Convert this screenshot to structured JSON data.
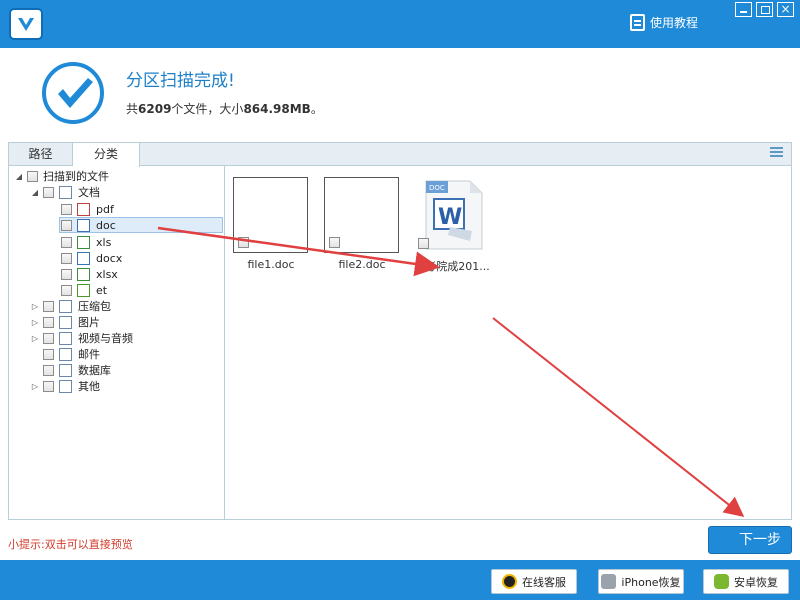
{
  "titlebar": {
    "tutorial_label": "使用教程",
    "close_glyph": "×"
  },
  "header": {
    "title": "分区扫描完成!",
    "stats_prefix": "共",
    "file_count": "6209",
    "stats_middle": "个文件，大小",
    "total_size": "864.98MB",
    "stats_suffix": "。"
  },
  "tabs": [
    {
      "label": "路径"
    },
    {
      "label": "分类"
    }
  ],
  "tree": {
    "root": {
      "label": "扫描到的文件",
      "expander": "◢"
    },
    "documents": {
      "label": "文档",
      "expander": "◢"
    },
    "doc_types": [
      {
        "label": "pdf"
      },
      {
        "label": "doc"
      },
      {
        "label": "xls"
      },
      {
        "label": "docx"
      },
      {
        "label": "xlsx"
      },
      {
        "label": "et"
      }
    ],
    "categories": [
      {
        "label": "压缩包",
        "expander": "▷"
      },
      {
        "label": "图片",
        "expander": "▷"
      },
      {
        "label": "视频与音频",
        "expander": "▷"
      },
      {
        "label": "邮件",
        "expander": ""
      },
      {
        "label": "数据库",
        "expander": ""
      },
      {
        "label": "其他",
        "expander": "▷"
      }
    ]
  },
  "files": [
    {
      "name": "file1.doc"
    },
    {
      "name": "file2.doc"
    },
    {
      "name": "睿考院成201...",
      "badge": "DOC"
    }
  ],
  "hint": "小提示:双击可以直接预览",
  "next_label": "下一步",
  "footer": {
    "service_label": "在线客服",
    "iphone_label": "iPhone恢复",
    "android_label": "安卓恢复"
  },
  "colors": {
    "primary": "#1e8ad8",
    "hint": "#d43a2a",
    "arrow": "#e04040"
  }
}
